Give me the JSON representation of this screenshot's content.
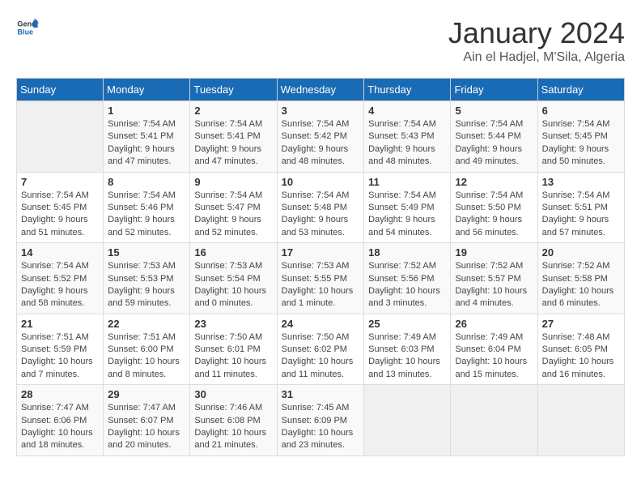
{
  "header": {
    "logo_line1": "General",
    "logo_line2": "Blue",
    "month_year": "January 2024",
    "location": "Ain el Hadjel, M'Sila, Algeria"
  },
  "weekdays": [
    "Sunday",
    "Monday",
    "Tuesday",
    "Wednesday",
    "Thursday",
    "Friday",
    "Saturday"
  ],
  "weeks": [
    [
      {
        "day": "",
        "sunrise": "",
        "sunset": "",
        "daylight": ""
      },
      {
        "day": "1",
        "sunrise": "Sunrise: 7:54 AM",
        "sunset": "Sunset: 5:41 PM",
        "daylight": "Daylight: 9 hours and 47 minutes."
      },
      {
        "day": "2",
        "sunrise": "Sunrise: 7:54 AM",
        "sunset": "Sunset: 5:41 PM",
        "daylight": "Daylight: 9 hours and 47 minutes."
      },
      {
        "day": "3",
        "sunrise": "Sunrise: 7:54 AM",
        "sunset": "Sunset: 5:42 PM",
        "daylight": "Daylight: 9 hours and 48 minutes."
      },
      {
        "day": "4",
        "sunrise": "Sunrise: 7:54 AM",
        "sunset": "Sunset: 5:43 PM",
        "daylight": "Daylight: 9 hours and 48 minutes."
      },
      {
        "day": "5",
        "sunrise": "Sunrise: 7:54 AM",
        "sunset": "Sunset: 5:44 PM",
        "daylight": "Daylight: 9 hours and 49 minutes."
      },
      {
        "day": "6",
        "sunrise": "Sunrise: 7:54 AM",
        "sunset": "Sunset: 5:45 PM",
        "daylight": "Daylight: 9 hours and 50 minutes."
      }
    ],
    [
      {
        "day": "7",
        "sunrise": "Sunrise: 7:54 AM",
        "sunset": "Sunset: 5:45 PM",
        "daylight": "Daylight: 9 hours and 51 minutes."
      },
      {
        "day": "8",
        "sunrise": "Sunrise: 7:54 AM",
        "sunset": "Sunset: 5:46 PM",
        "daylight": "Daylight: 9 hours and 52 minutes."
      },
      {
        "day": "9",
        "sunrise": "Sunrise: 7:54 AM",
        "sunset": "Sunset: 5:47 PM",
        "daylight": "Daylight: 9 hours and 52 minutes."
      },
      {
        "day": "10",
        "sunrise": "Sunrise: 7:54 AM",
        "sunset": "Sunset: 5:48 PM",
        "daylight": "Daylight: 9 hours and 53 minutes."
      },
      {
        "day": "11",
        "sunrise": "Sunrise: 7:54 AM",
        "sunset": "Sunset: 5:49 PM",
        "daylight": "Daylight: 9 hours and 54 minutes."
      },
      {
        "day": "12",
        "sunrise": "Sunrise: 7:54 AM",
        "sunset": "Sunset: 5:50 PM",
        "daylight": "Daylight: 9 hours and 56 minutes."
      },
      {
        "day": "13",
        "sunrise": "Sunrise: 7:54 AM",
        "sunset": "Sunset: 5:51 PM",
        "daylight": "Daylight: 9 hours and 57 minutes."
      }
    ],
    [
      {
        "day": "14",
        "sunrise": "Sunrise: 7:54 AM",
        "sunset": "Sunset: 5:52 PM",
        "daylight": "Daylight: 9 hours and 58 minutes."
      },
      {
        "day": "15",
        "sunrise": "Sunrise: 7:53 AM",
        "sunset": "Sunset: 5:53 PM",
        "daylight": "Daylight: 9 hours and 59 minutes."
      },
      {
        "day": "16",
        "sunrise": "Sunrise: 7:53 AM",
        "sunset": "Sunset: 5:54 PM",
        "daylight": "Daylight: 10 hours and 0 minutes."
      },
      {
        "day": "17",
        "sunrise": "Sunrise: 7:53 AM",
        "sunset": "Sunset: 5:55 PM",
        "daylight": "Daylight: 10 hours and 1 minute."
      },
      {
        "day": "18",
        "sunrise": "Sunrise: 7:52 AM",
        "sunset": "Sunset: 5:56 PM",
        "daylight": "Daylight: 10 hours and 3 minutes."
      },
      {
        "day": "19",
        "sunrise": "Sunrise: 7:52 AM",
        "sunset": "Sunset: 5:57 PM",
        "daylight": "Daylight: 10 hours and 4 minutes."
      },
      {
        "day": "20",
        "sunrise": "Sunrise: 7:52 AM",
        "sunset": "Sunset: 5:58 PM",
        "daylight": "Daylight: 10 hours and 6 minutes."
      }
    ],
    [
      {
        "day": "21",
        "sunrise": "Sunrise: 7:51 AM",
        "sunset": "Sunset: 5:59 PM",
        "daylight": "Daylight: 10 hours and 7 minutes."
      },
      {
        "day": "22",
        "sunrise": "Sunrise: 7:51 AM",
        "sunset": "Sunset: 6:00 PM",
        "daylight": "Daylight: 10 hours and 8 minutes."
      },
      {
        "day": "23",
        "sunrise": "Sunrise: 7:50 AM",
        "sunset": "Sunset: 6:01 PM",
        "daylight": "Daylight: 10 hours and 11 minutes."
      },
      {
        "day": "24",
        "sunrise": "Sunrise: 7:50 AM",
        "sunset": "Sunset: 6:02 PM",
        "daylight": "Daylight: 10 hours and 11 minutes."
      },
      {
        "day": "25",
        "sunrise": "Sunrise: 7:49 AM",
        "sunset": "Sunset: 6:03 PM",
        "daylight": "Daylight: 10 hours and 13 minutes."
      },
      {
        "day": "26",
        "sunrise": "Sunrise: 7:49 AM",
        "sunset": "Sunset: 6:04 PM",
        "daylight": "Daylight: 10 hours and 15 minutes."
      },
      {
        "day": "27",
        "sunrise": "Sunrise: 7:48 AM",
        "sunset": "Sunset: 6:05 PM",
        "daylight": "Daylight: 10 hours and 16 minutes."
      }
    ],
    [
      {
        "day": "28",
        "sunrise": "Sunrise: 7:47 AM",
        "sunset": "Sunset: 6:06 PM",
        "daylight": "Daylight: 10 hours and 18 minutes."
      },
      {
        "day": "29",
        "sunrise": "Sunrise: 7:47 AM",
        "sunset": "Sunset: 6:07 PM",
        "daylight": "Daylight: 10 hours and 20 minutes."
      },
      {
        "day": "30",
        "sunrise": "Sunrise: 7:46 AM",
        "sunset": "Sunset: 6:08 PM",
        "daylight": "Daylight: 10 hours and 21 minutes."
      },
      {
        "day": "31",
        "sunrise": "Sunrise: 7:45 AM",
        "sunset": "Sunset: 6:09 PM",
        "daylight": "Daylight: 10 hours and 23 minutes."
      },
      {
        "day": "",
        "sunrise": "",
        "sunset": "",
        "daylight": ""
      },
      {
        "day": "",
        "sunrise": "",
        "sunset": "",
        "daylight": ""
      },
      {
        "day": "",
        "sunrise": "",
        "sunset": "",
        "daylight": ""
      }
    ]
  ]
}
